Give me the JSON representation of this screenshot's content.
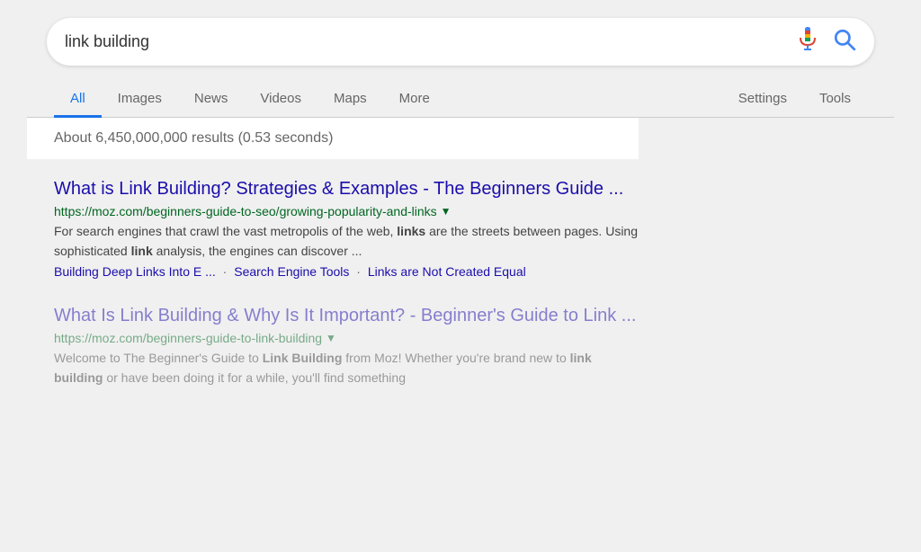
{
  "searchBar": {
    "query": "link building",
    "placeholder": "link building"
  },
  "nav": {
    "tabs": [
      {
        "label": "All",
        "active": true
      },
      {
        "label": "Images",
        "active": false
      },
      {
        "label": "News",
        "active": false
      },
      {
        "label": "Videos",
        "active": false
      },
      {
        "label": "Maps",
        "active": false
      },
      {
        "label": "More",
        "active": false
      }
    ],
    "rightTabs": [
      {
        "label": "Settings"
      },
      {
        "label": "Tools"
      }
    ]
  },
  "resultsCount": "About 6,450,000,000 results (0.53 seconds)",
  "results": [
    {
      "title": "What is Link Building? Strategies & Examples - The Beginners Guide ...",
      "url": "https://moz.com/beginners-guide-to-seo/growing-popularity-and-links",
      "snippet_plain": "For search engines that crawl the vast metropolis of the web, ",
      "snippet_bold1": "links",
      "snippet_mid": " are the streets between pages. Using sophisticated ",
      "snippet_bold2": "link",
      "snippet_end": " analysis, the engines can discover ...",
      "breadcrumbs": [
        "Building Deep Links Into E ...",
        "Search Engine Tools",
        "Links are Not Created Equal"
      ]
    },
    {
      "title": "What Is Link Building & Why Is It Important? - Beginner's Guide to Link ...",
      "url": "https://moz.com/beginners-guide-to-link-building",
      "snippet": "Welcome to The Beginner's Guide to Link Building from Moz! Whether you're brand new to link building or have been doing it for a while, you'll find something",
      "breadcrumbs": []
    }
  ],
  "icons": {
    "mic": "mic-icon",
    "search": "search-icon"
  }
}
